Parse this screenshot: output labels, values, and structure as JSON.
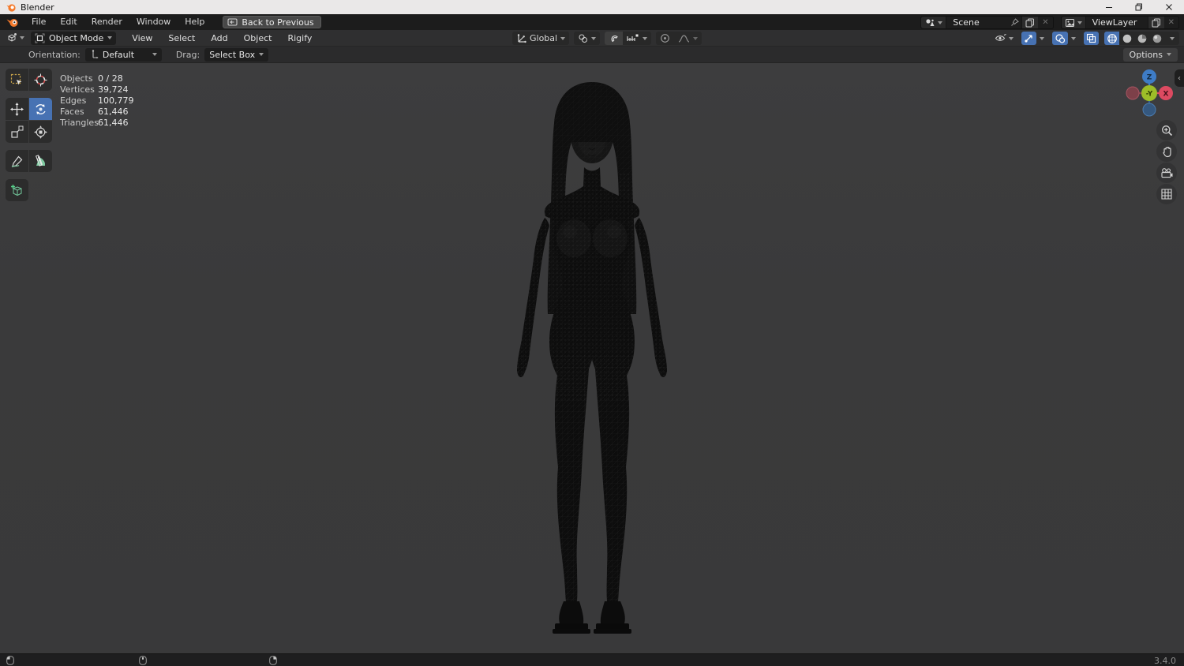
{
  "window": {
    "title": "Blender"
  },
  "menu_bar": {
    "menus": [
      "File",
      "Edit",
      "Render",
      "Window",
      "Help"
    ],
    "back_button": "Back to Previous",
    "scene_selector": {
      "value": "Scene"
    },
    "view_layer_selector": {
      "value": "ViewLayer"
    }
  },
  "tool_header": {
    "mode": "Object Mode",
    "menus": [
      "View",
      "Select",
      "Add",
      "Object",
      "Rigify"
    ],
    "orientation": "Global",
    "options": "Options"
  },
  "tool_settings": {
    "orientation_label": "Orientation:",
    "orientation_value": "Default",
    "drag_label": "Drag:",
    "drag_value": "Select Box"
  },
  "stats": {
    "rows": [
      {
        "label": "Objects",
        "value": "0 / 28"
      },
      {
        "label": "Vertices",
        "value": "39,724"
      },
      {
        "label": "Edges",
        "value": "100,779"
      },
      {
        "label": "Faces",
        "value": "61,446"
      },
      {
        "label": "Triangles",
        "value": "61,446"
      }
    ]
  },
  "nav_gizmo": {
    "z": "Z",
    "x": "X",
    "neg_y": "-Y"
  },
  "status_bar": {
    "version": "3.4.0"
  },
  "colors": {
    "accent_blue": "#4772b3",
    "axis_x": "#dd4a61",
    "axis_y_front": "#9dbd28",
    "axis_z": "#3e7cc6",
    "viewport_bg": "#3a3a3b"
  }
}
